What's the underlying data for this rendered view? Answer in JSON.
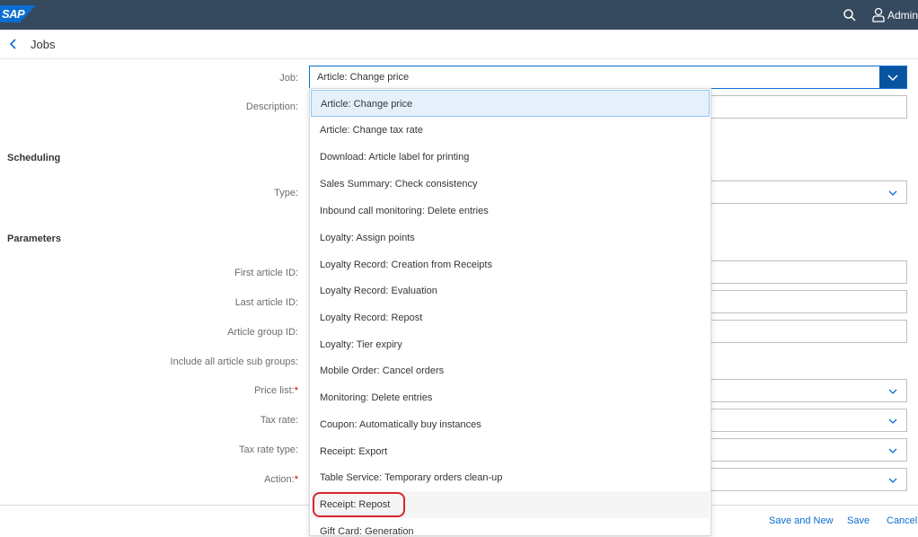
{
  "shell": {
    "logo": "SAP",
    "user": "Admin"
  },
  "header": {
    "title": "Jobs"
  },
  "form": {
    "job_label": "Job:",
    "job_value": "Article: Change price",
    "description_label": "Description:",
    "scheduling_heading": "Scheduling",
    "type_label": "Type:",
    "parameters_heading": "Parameters",
    "first_article_label": "First article ID:",
    "last_article_label": "Last article ID:",
    "article_group_label": "Article group ID:",
    "include_subgroups_label": "Include all article sub groups:",
    "price_list_label": "Price list:",
    "tax_rate_label": "Tax rate:",
    "tax_rate_type_label": "Tax rate type:",
    "action_label": "Action:",
    "required_marker": "*"
  },
  "dropdown": {
    "options": [
      "Article: Change price",
      "Article: Change tax rate",
      "Download: Article label for printing",
      "Sales Summary: Check consistency",
      "Inbound call monitoring: Delete entries",
      "Loyalty: Assign points",
      "Loyalty Record: Creation from Receipts",
      "Loyalty Record: Evaluation",
      "Loyalty Record: Repost",
      "Loyalty: Tier expiry",
      "Mobile Order: Cancel orders",
      "Monitoring: Delete entries",
      "Coupon: Automatically buy instances",
      "Receipt: Export",
      "Table Service: Temporary orders clean-up",
      "Receipt: Repost",
      "Gift Card: Generation"
    ],
    "selected_index": 0,
    "highlighted_option": "Receipt: Repost"
  },
  "footer": {
    "save_and_new": "Save and New",
    "save": "Save",
    "cancel": "Cancel"
  },
  "colors": {
    "shell": "#354a5f",
    "accent": "#0a6ed1",
    "highlight_ring": "#d5262d"
  }
}
